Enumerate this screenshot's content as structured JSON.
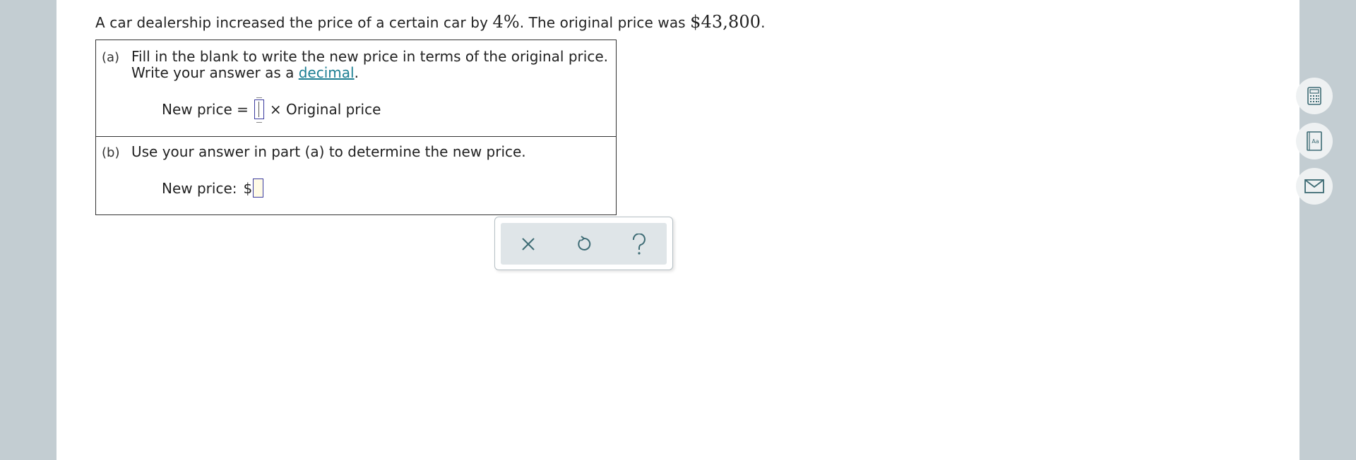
{
  "problem": {
    "text_1": "A car dealership increased the price of a certain car by ",
    "percent": "4%",
    "text_2": ". The original price was ",
    "original_price": "$43,800",
    "text_3": "."
  },
  "part_a": {
    "letter": "(a)",
    "line1": "Fill in the blank to write the new price in terms of the original price.",
    "line2_prefix": "Write your answer as a ",
    "line2_link": "decimal",
    "line2_suffix": ".",
    "eq_left": "New price =",
    "eq_right": "× Original price",
    "answer_value": ""
  },
  "part_b": {
    "letter": "(b)",
    "line1": "Use your answer in part (a) to determine the new price.",
    "label": "New price:",
    "currency": "$",
    "answer_value": ""
  },
  "toolbar": {
    "clear_icon": "close-icon",
    "undo_icon": "undo-icon",
    "help_icon": "help-icon"
  },
  "side_tools": {
    "calculator_icon": "calculator-icon",
    "glossary_icon": "glossary-icon",
    "message_icon": "mail-icon"
  },
  "colors": {
    "link": "#1d7f93",
    "answer_border": "#3b3b9e",
    "page_bg": "#c3cdd2",
    "icon": "#3d6b74"
  }
}
